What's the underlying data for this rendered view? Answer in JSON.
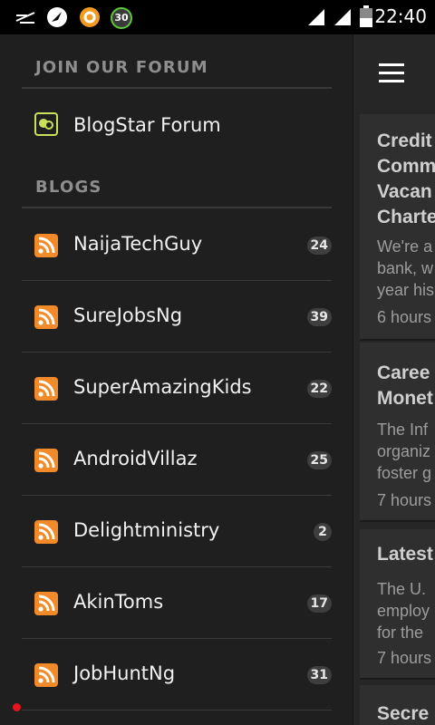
{
  "status_bar": {
    "time": "22:40",
    "notif_badge": "30",
    "icons": [
      "signal-strength-icon",
      "speed-icon",
      "compass-icon",
      "ring-app-icon",
      "badge-30-icon",
      "wifi-icon",
      "cell-signal-icon",
      "battery-icon"
    ]
  },
  "drawer": {
    "join_header": "JOIN OUR FORUM",
    "forum_label": "BlogStar Forum",
    "blogs_header": "BLOGS",
    "blogs": [
      {
        "name": "NaijaTechGuy",
        "count": "24"
      },
      {
        "name": "SureJobsNg",
        "count": "39"
      },
      {
        "name": "SuperAmazingKids",
        "count": "22"
      },
      {
        "name": "AndroidVillaz",
        "count": "25"
      },
      {
        "name": "Delightministry",
        "count": "2"
      },
      {
        "name": "AkinToms",
        "count": "17"
      },
      {
        "name": "JobHuntNg",
        "count": "31"
      }
    ]
  },
  "feed": {
    "cards": [
      {
        "title": "Credit\nComm\nVacan\nCharte",
        "snippet": "We're a\nbank, w\nyear his",
        "time": "6 hours"
      },
      {
        "title": "Caree\nMonet",
        "snippet": "The Inf\norganiz\nfoster g",
        "time": "7 hours"
      },
      {
        "title": "Latest",
        "snippet": "The U.\nemploy\nfor the",
        "time": "7 hours"
      },
      {
        "title": "Secre",
        "snippet": "",
        "time": ""
      }
    ]
  },
  "colors": {
    "accent_rss": "#f38a2a",
    "accent_forum": "#c8e05a",
    "notification_dot": "#e5141e"
  }
}
